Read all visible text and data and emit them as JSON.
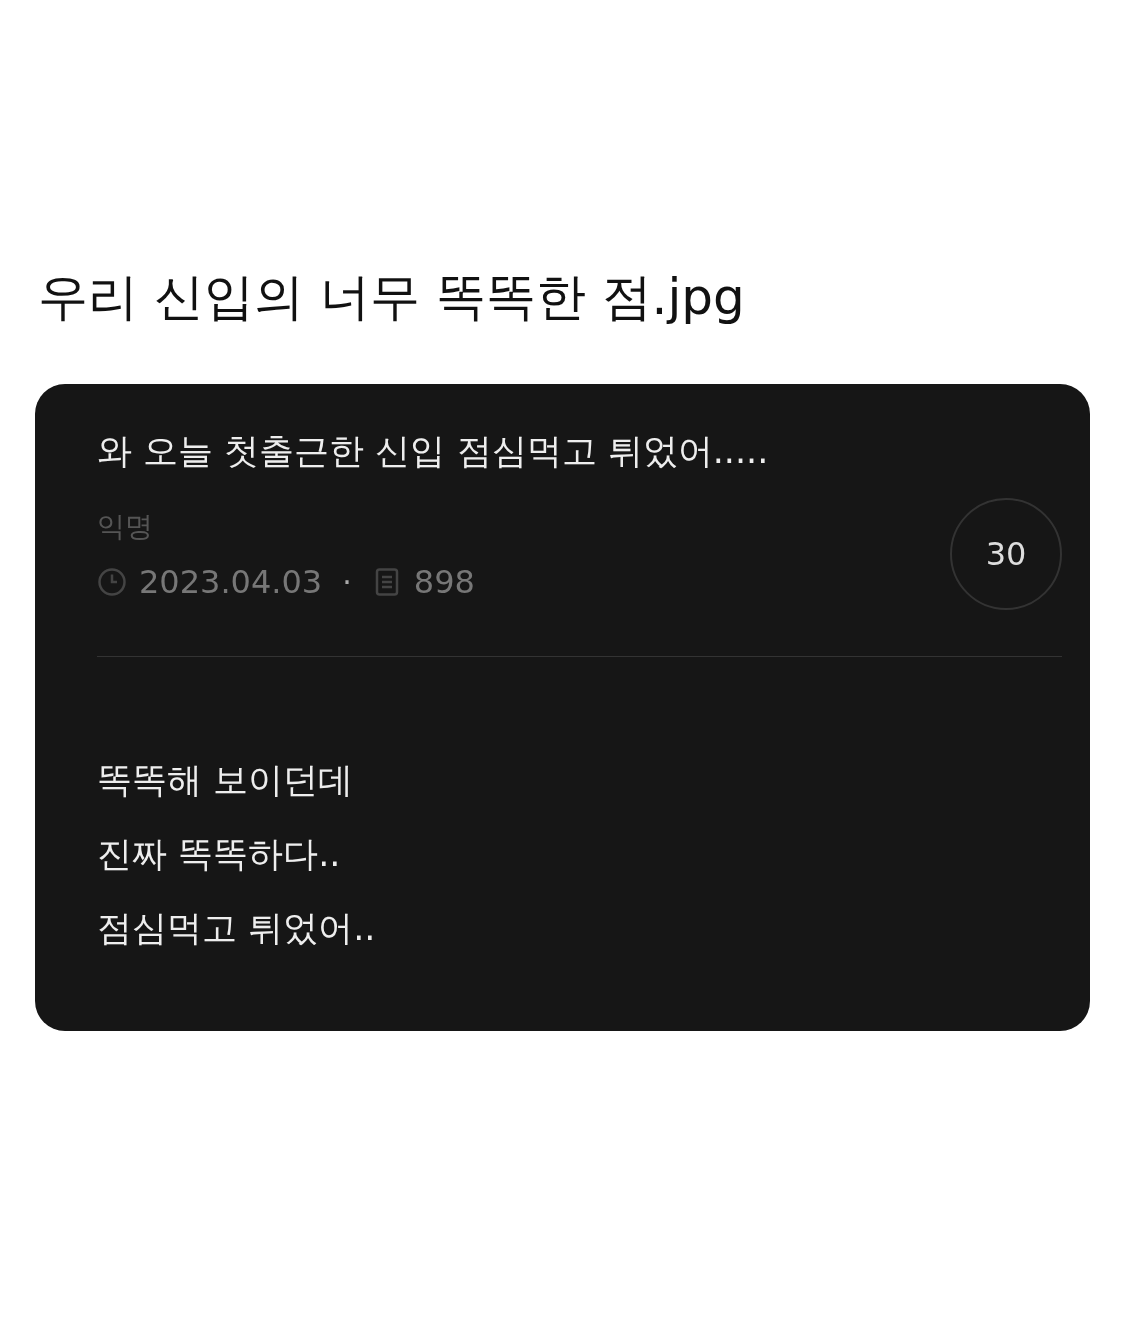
{
  "headline": "우리 신입의 너무 똑똑한 점.jpg",
  "post": {
    "title": "와 오늘 첫출근한 신입 점심먹고 튀었어.....",
    "author": "익명",
    "date": "2023.04.03",
    "separator": "·",
    "views": "898",
    "comment_count": "30",
    "body": [
      "똑똑해 보이던데",
      "진짜 똑똑하다..",
      "점심먹고 튀었어.."
    ]
  }
}
